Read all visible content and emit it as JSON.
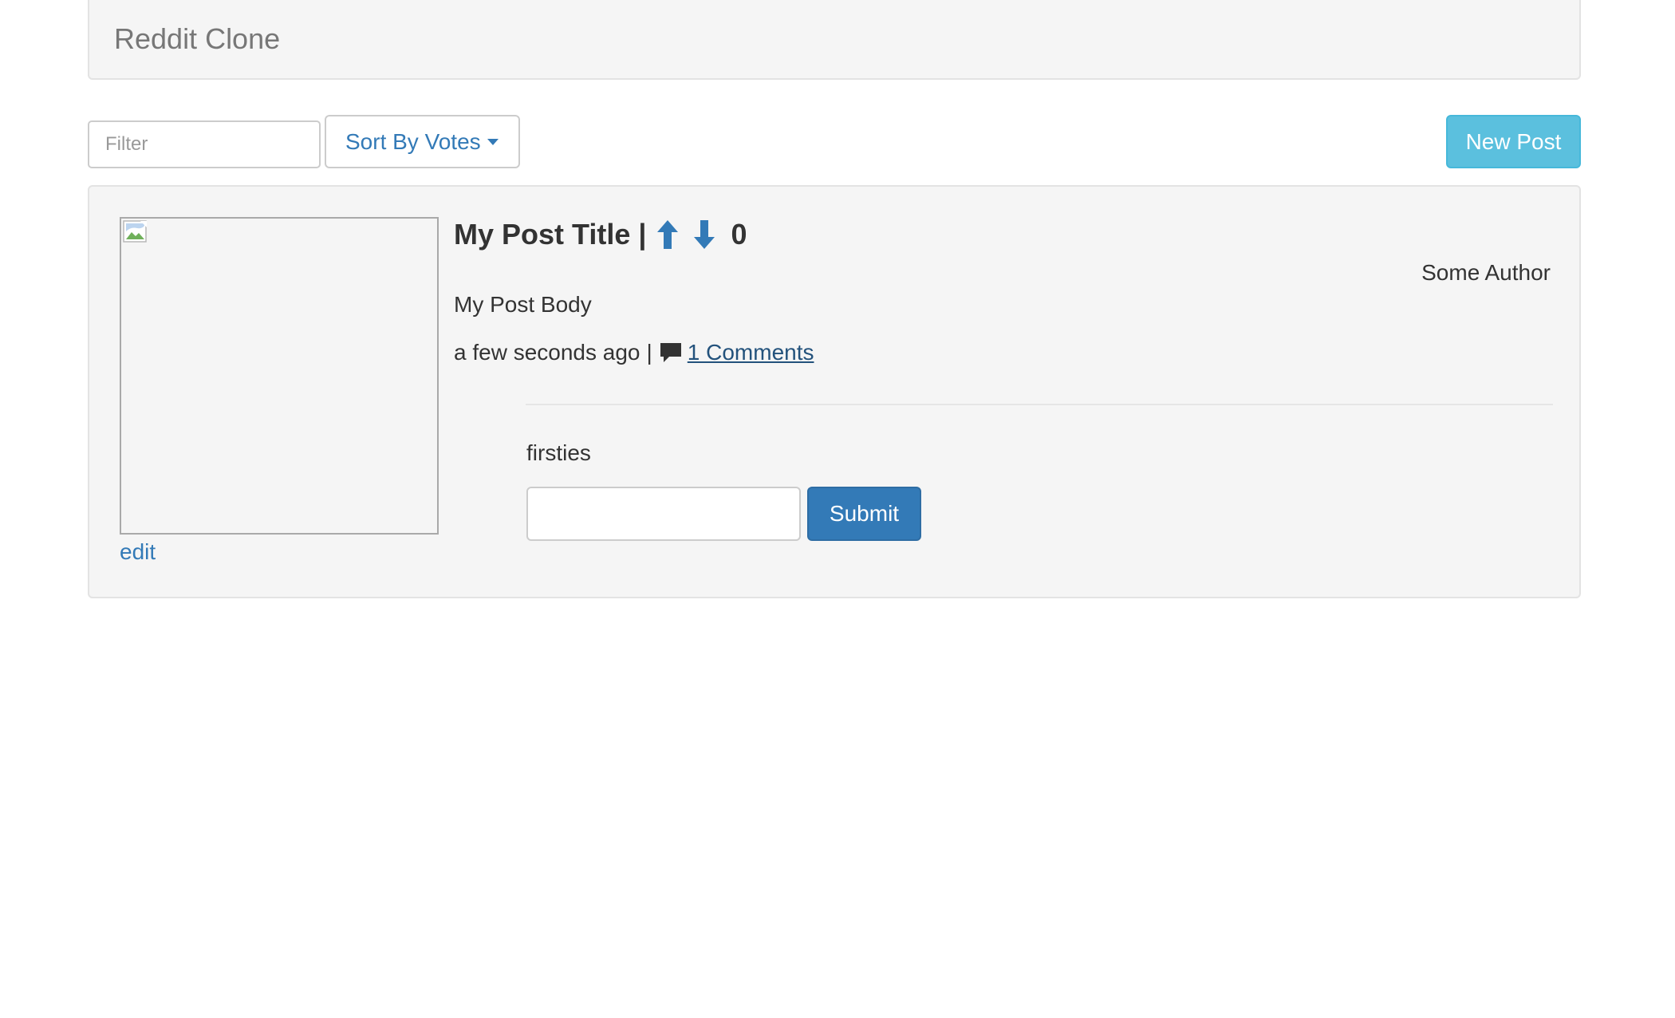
{
  "navbar": {
    "brand": "Reddit Clone"
  },
  "toolbar": {
    "filter_placeholder": "Filter",
    "sort_label": "Sort By Votes",
    "new_post_label": "New Post"
  },
  "colors": {
    "link": "#337ab7",
    "info_button": "#5bc0de",
    "primary_button": "#337ab7",
    "well_background": "#f5f5f5"
  },
  "post": {
    "title": "My Post Title",
    "separator": "|",
    "upvote_icon": "arrow-up-icon",
    "downvote_icon": "arrow-down-icon",
    "votes": "0",
    "author": "Some Author",
    "body": "My Post Body",
    "timestamp": "a few seconds ago",
    "meta_separator": "|",
    "comment_icon": "comment-icon",
    "comments_link": "1 Comments",
    "edit_label": "edit",
    "image_icon": "broken-image-icon"
  },
  "comments": {
    "items": [
      {
        "text": "firsties"
      }
    ],
    "input_value": "",
    "submit_label": "Submit"
  }
}
